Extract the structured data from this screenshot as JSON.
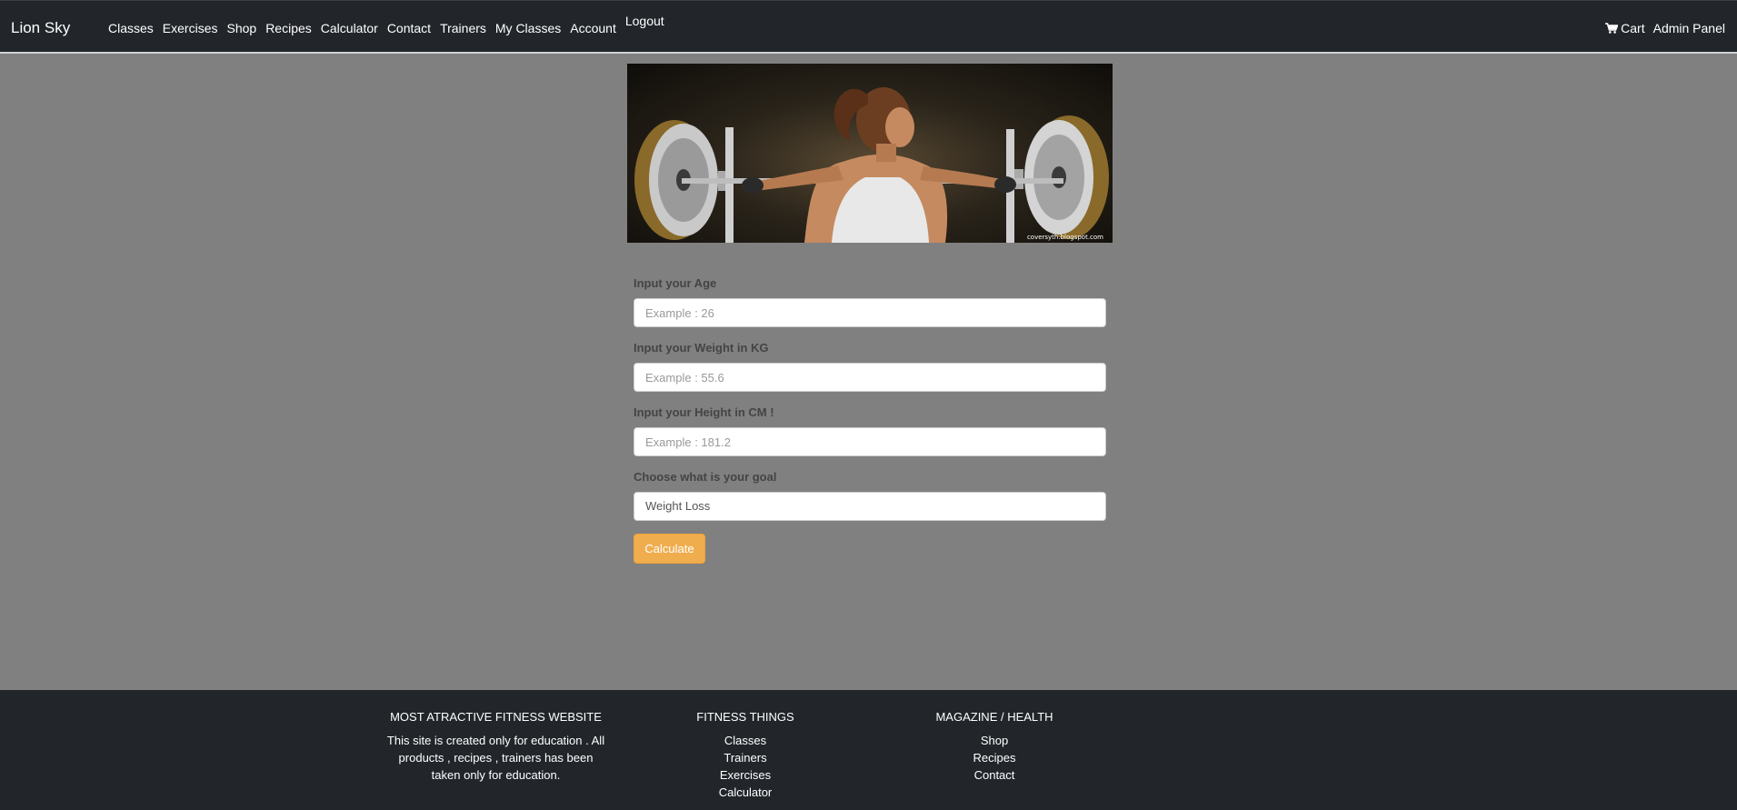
{
  "header": {
    "brand": "Lion Sky",
    "nav": [
      "Classes",
      "Exercises",
      "Shop",
      "Recipes",
      "Calculator",
      "Contact",
      "Trainers",
      "My Classes",
      "Account",
      "Logout"
    ],
    "cart_label": "Cart",
    "admin_label": "Admin Panel",
    "cart_icon": "shopping-cart-icon"
  },
  "hero": {
    "alt": "Woman lifting a barbell in a gym",
    "credit": "coversyth.blogspot.com"
  },
  "form": {
    "age_label": "Input your Age",
    "age_placeholder": "Example : 26",
    "weight_label": "Input your Weight in KG",
    "weight_placeholder": "Example : 55.6",
    "height_label": "Input your Height in CM !",
    "height_placeholder": "Example : 181.2",
    "goal_label": "Choose what is your goal",
    "goal_selected": "Weight Loss",
    "button": "Calculate"
  },
  "footer": {
    "about_title": "MOST ATRACTIVE FITNESS WEBSITE",
    "about_text": "This site is created only for education . All products , recipes , trainers has been taken only for education.",
    "things_title": "FITNESS THINGS",
    "things_links": [
      "Classes",
      "Trainers",
      "Exercises",
      "Calculator"
    ],
    "magazine_title": "MAGAZINE / HEALTH",
    "magazine_links": [
      "Shop",
      "Recipes",
      "Contact"
    ]
  },
  "colors": {
    "navbar": "#22262b",
    "page_background": "#808080",
    "button_orange": "#f0ad4e"
  }
}
